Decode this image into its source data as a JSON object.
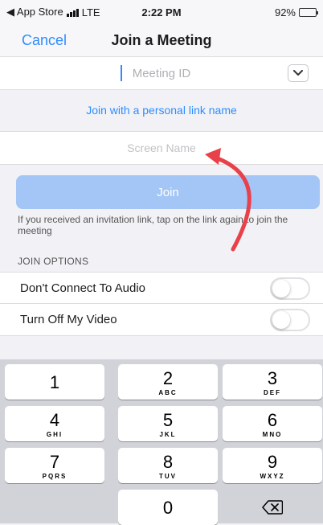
{
  "status_bar": {
    "carrier": "◀ App Store",
    "network": "LTE",
    "time": "2:22 PM",
    "battery": "92%"
  },
  "nav": {
    "cancel_label": "Cancel",
    "title": "Join a Meeting"
  },
  "meeting_id": {
    "placeholder": "Meeting ID",
    "value": ""
  },
  "personal_link_label": "Join with a personal link name",
  "screen_name": {
    "placeholder": "Screen Name",
    "value": ""
  },
  "join_button_label": "Join",
  "hint_text": "If you received an invitation link, tap on the link again to join the meeting",
  "join_options": {
    "header": "JOIN OPTIONS",
    "items": [
      {
        "label": "Don't Connect To Audio",
        "on": false
      },
      {
        "label": "Turn Off My Video",
        "on": false
      }
    ]
  },
  "keypad": {
    "keys": [
      {
        "digit": "1",
        "letters": ""
      },
      {
        "digit": "2",
        "letters": "ABC"
      },
      {
        "digit": "3",
        "letters": "DEF"
      },
      {
        "digit": "4",
        "letters": "GHI"
      },
      {
        "digit": "5",
        "letters": "JKL"
      },
      {
        "digit": "6",
        "letters": "MNO"
      },
      {
        "digit": "7",
        "letters": "PQRS"
      },
      {
        "digit": "8",
        "letters": "TUV"
      },
      {
        "digit": "9",
        "letters": "WXYZ"
      },
      {
        "digit": "0",
        "letters": ""
      }
    ],
    "delete_icon": "backspace-icon"
  },
  "colors": {
    "accent": "#2d8cff",
    "join_button": "#a3c6f6",
    "annotation_arrow": "#e8414a"
  }
}
